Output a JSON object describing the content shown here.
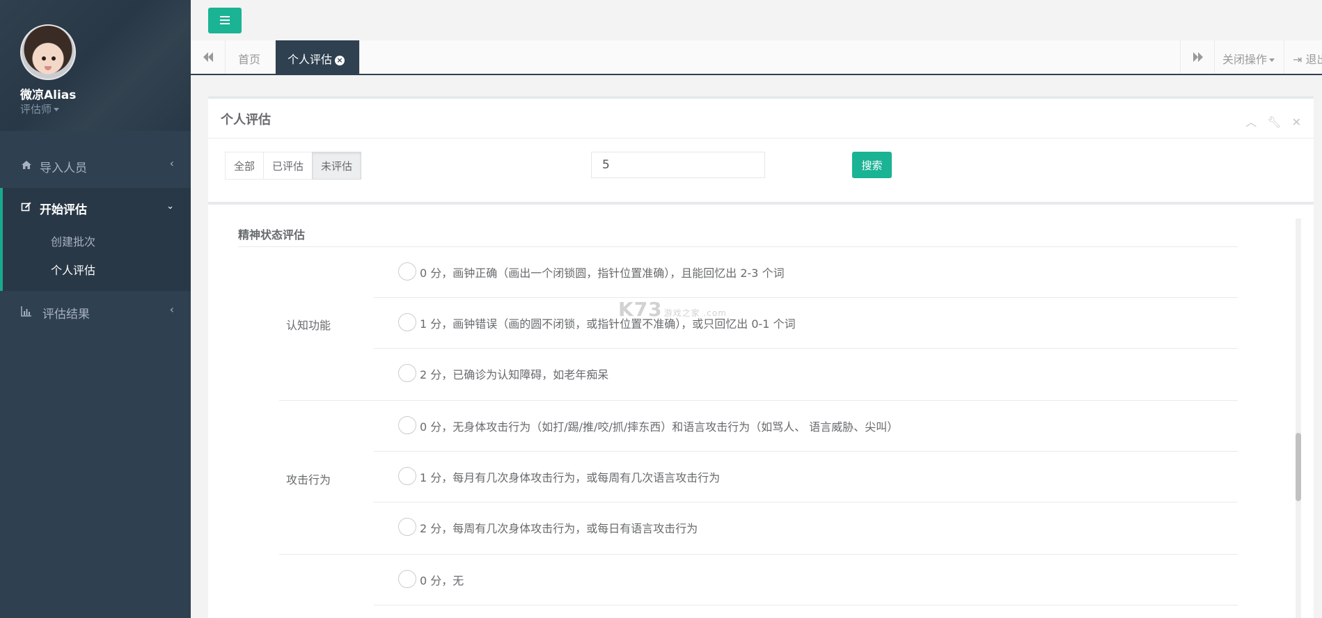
{
  "sidebar": {
    "username": "微凉Alias",
    "role": "评估师",
    "nav": [
      {
        "label": "导入人员",
        "icon": "home-icon"
      },
      {
        "label": "开始评估",
        "icon": "edit-icon"
      },
      {
        "label": "评估结果",
        "icon": "bar-chart-icon"
      }
    ],
    "sub": [
      "创建批次",
      "个人评估"
    ]
  },
  "tabs": {
    "home": "首页",
    "active": "个人评估",
    "close_ops": "关闭操作",
    "logout": "退出"
  },
  "panel": {
    "title": "个人评估",
    "filters": [
      "全部",
      "已评估",
      "未评估"
    ],
    "selected_filter": "未评估",
    "search_value": "5",
    "search_button": "搜索"
  },
  "form": {
    "section_title": "精神状态评估",
    "groups": [
      {
        "label": "认知功能",
        "options": [
          "0 分，画钟正确（画出一个闭锁圆，指针位置准确），且能回忆出 2-3 个词",
          "1 分，画钟错误（画的圆不闭锁，或指针位置不准确），或只回忆出 0-1 个词",
          "2 分，已确诊为认知障碍，如老年痴呆"
        ]
      },
      {
        "label": "攻击行为",
        "options": [
          "0 分，无身体攻击行为（如打/踢/推/咬/抓/摔东西）和语言攻击行为（如骂人、 语言威胁、尖叫）",
          "1 分，每月有几次身体攻击行为，或每周有几次语言攻击行为",
          "2 分，每周有几次身体攻击行为，或每日有语言攻击行为"
        ]
      },
      {
        "label": "",
        "options": [
          "0 分，无"
        ]
      }
    ]
  },
  "watermark": {
    "main": "K73",
    "sub": "游戏之家 .com"
  }
}
